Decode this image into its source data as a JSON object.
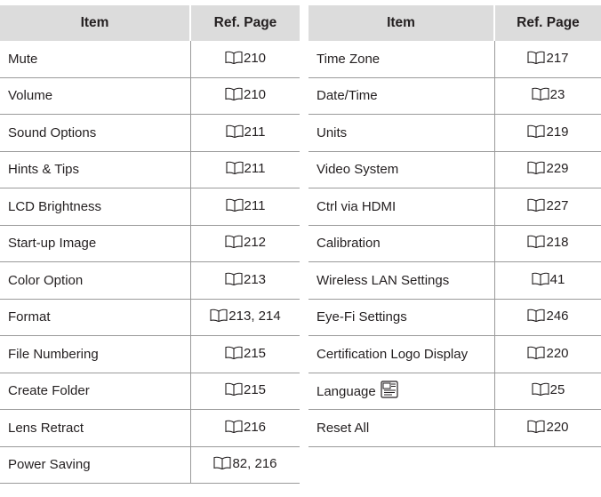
{
  "headers": {
    "item": "Item",
    "ref_page": "Ref. Page"
  },
  "left_rows": [
    {
      "item": "Mute",
      "ref": "210"
    },
    {
      "item": "Volume",
      "ref": "210"
    },
    {
      "item": "Sound Options",
      "ref": "211"
    },
    {
      "item": "Hints & Tips",
      "ref": "211"
    },
    {
      "item": "LCD Brightness",
      "ref": "211"
    },
    {
      "item": "Start-up Image",
      "ref": "212"
    },
    {
      "item": "Color Option",
      "ref": "213"
    },
    {
      "item": "Format",
      "ref": "213, 214"
    },
    {
      "item": "File Numbering",
      "ref": "215"
    },
    {
      "item": "Create Folder",
      "ref": "215"
    },
    {
      "item": "Lens Retract",
      "ref": "216"
    },
    {
      "item": "Power Saving",
      "ref": "82, 216"
    }
  ],
  "right_rows": [
    {
      "item": "Time Zone",
      "ref": "217"
    },
    {
      "item": "Date/Time",
      "ref": "23"
    },
    {
      "item": "Units",
      "ref": "219"
    },
    {
      "item": "Video System",
      "ref": "229"
    },
    {
      "item": "Ctrl via HDMI",
      "ref": "227"
    },
    {
      "item": "Calibration",
      "ref": "218"
    },
    {
      "item": "Wireless LAN Settings",
      "ref": "41"
    },
    {
      "item": "Eye-Fi Settings",
      "ref": "246"
    },
    {
      "item": "Certification Logo Display",
      "ref": "220"
    },
    {
      "item": "Language",
      "ref": "25",
      "icon": "language-menu-icon"
    },
    {
      "item": "Reset All",
      "ref": "220"
    }
  ],
  "colors": {
    "header_bg": "#dcdcdc",
    "rule": "#9a9a9a",
    "text": "#231f20"
  },
  "icons": {
    "page_ref": "book-icon",
    "language": "language-menu-icon"
  }
}
